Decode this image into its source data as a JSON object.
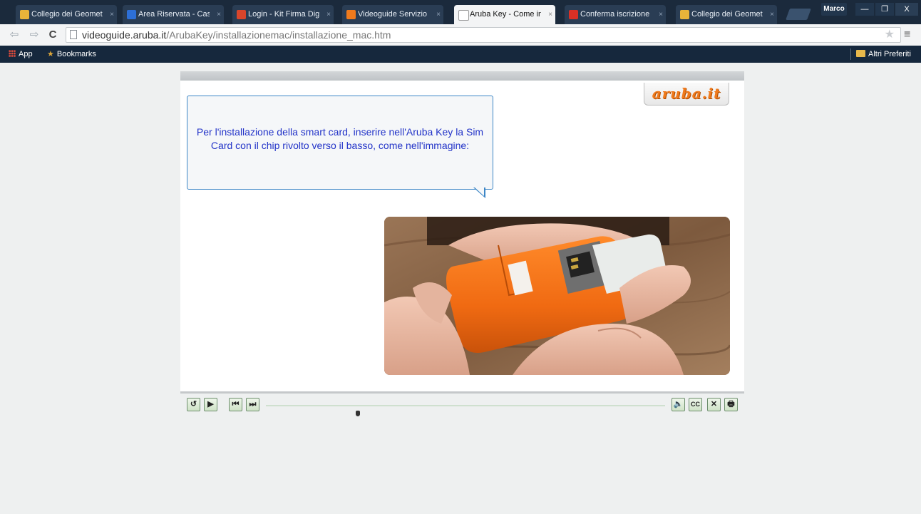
{
  "browser": {
    "tabs": [
      {
        "title": "Collegio dei Geomet",
        "favicon_color": "#e8b43a",
        "active": false
      },
      {
        "title": "Area Riservata - Cass",
        "favicon_color": "#2d6fd6",
        "active": false
      },
      {
        "title": "Login - Kit Firma Dig",
        "favicon_color": "#d9452b",
        "active": false
      },
      {
        "title": "Videoguide Servizio",
        "favicon_color": "#f07a1c",
        "active": false
      },
      {
        "title": "Aruba Key - Come in",
        "favicon_color": "#ffffff",
        "active": true
      },
      {
        "title": "Conferma iscrizione",
        "favicon_color": "#d93025",
        "active": false
      },
      {
        "title": "Collegio dei Geomet",
        "favicon_color": "#e8b43a",
        "active": false
      }
    ],
    "tab_close_glyph": "×",
    "user_name": "Marco",
    "window_controls": {
      "minimize": "—",
      "restore": "❐",
      "close": "X"
    },
    "url_host": "videoguide.aruba.it",
    "url_path": "/ArubaKey/installazionemac/installazione_mac.htm",
    "bookmarks": {
      "apps_label": "App",
      "bookmarks_label": "Bookmarks",
      "other_label": "Altri Preferiti"
    }
  },
  "player": {
    "logo_text": "aruba.it",
    "instruction_text": "Per l'installazione della smart card, inserire nell'Aruba Key la Sim Card con il chip rivolto verso il basso, come nell'immagine:",
    "progress_fraction": 0.23,
    "controls": {
      "rewind_icon": "↺",
      "play_icon": "▶",
      "prev_icon": "⏮",
      "next_icon": "⏭",
      "volume_icon": "🔈",
      "cc_label": "CC",
      "close_icon": "✕",
      "print_icon": "🖶"
    }
  },
  "colors": {
    "accent_orange": "#f07a1c",
    "instruction_text": "#2233c8",
    "bubble_border": "#3c86c6"
  }
}
